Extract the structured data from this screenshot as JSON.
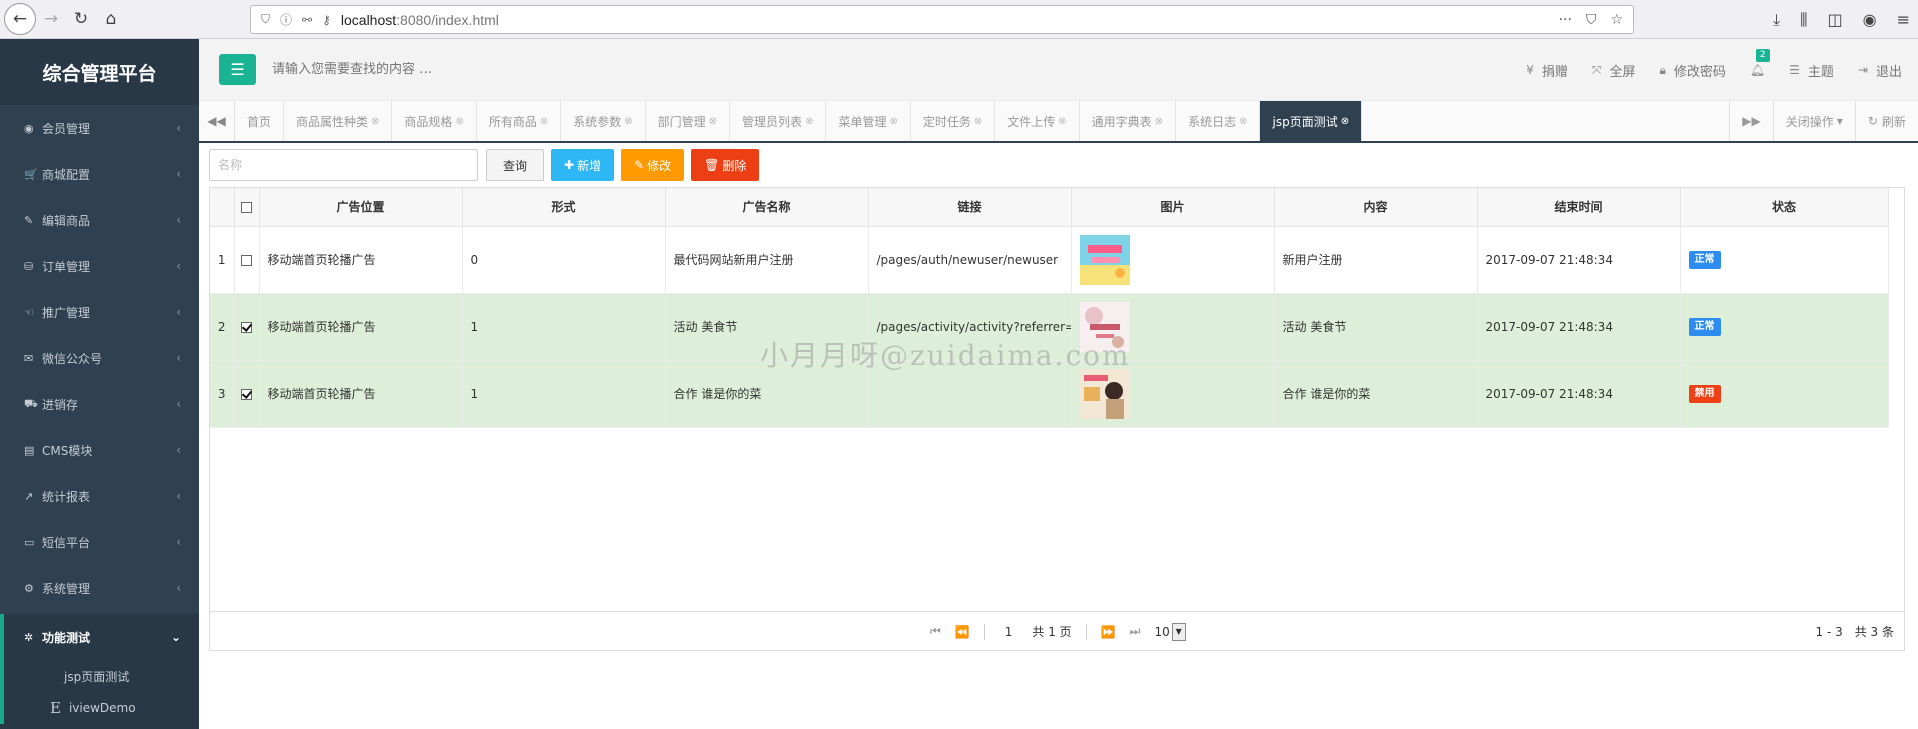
{
  "browser": {
    "url_host": "localhost",
    "url_rest": ":8080/index.html"
  },
  "sidebar": {
    "brand": "综合管理平台",
    "items": [
      {
        "icon": "user-circle-icon",
        "glyph": "◉",
        "label": "会员管理"
      },
      {
        "icon": "cart-icon",
        "glyph": "🛒",
        "label": "商城配置"
      },
      {
        "icon": "edit-icon",
        "glyph": "✎",
        "label": "编辑商品"
      },
      {
        "icon": "database-icon",
        "glyph": "⛁",
        "label": "订单管理"
      },
      {
        "icon": "hand-icon",
        "glyph": "☜",
        "label": "推广管理"
      },
      {
        "icon": "wechat-icon",
        "glyph": "✉",
        "label": "微信公众号"
      },
      {
        "icon": "truck-icon",
        "glyph": "⛟",
        "label": "进销存"
      },
      {
        "icon": "book-icon",
        "glyph": "▤",
        "label": "CMS模块"
      },
      {
        "icon": "chart-line-icon",
        "glyph": "↗",
        "label": "统计报表"
      },
      {
        "icon": "monitor-icon",
        "glyph": "▭",
        "label": "短信平台"
      },
      {
        "icon": "gear-icon",
        "glyph": "⚙",
        "label": "系统管理"
      }
    ],
    "active": {
      "icon": "bug-icon",
      "glyph": "✲",
      "label": "功能测试"
    },
    "sub": [
      {
        "label": "jsp页面测试"
      },
      {
        "icon_letter": "E",
        "label": "iviewDemo"
      }
    ]
  },
  "topbar": {
    "search_placeholder": "请输入您需要查找的内容 …",
    "actions": {
      "donate": "捐赠",
      "fullscreen": "全屏",
      "change_password": "修改密码",
      "notify_count": "2",
      "theme": "主题",
      "logout": "退出"
    }
  },
  "tabs": {
    "items": [
      "首页",
      "商品属性种类",
      "商品规格",
      "所有商品",
      "系统参数",
      "部门管理",
      "管理员列表",
      "菜单管理",
      "定时任务",
      "文件上传",
      "通用字典表",
      "系统日志",
      "jsp页面测试"
    ],
    "close_ops": "关闭操作",
    "refresh": "刷新"
  },
  "toolbar": {
    "name_placeholder": "名称",
    "query": "查询",
    "add": "新增",
    "edit": "修改",
    "delete": "删除"
  },
  "table": {
    "headers": [
      "广告位置",
      "形式",
      "广告名称",
      "链接",
      "图片",
      "内容",
      "结束时间",
      "状态"
    ],
    "rows": [
      {
        "no": "1",
        "checked": false,
        "position": "移动端首页轮播广告",
        "form": "0",
        "name": "最代码网站新用户注册",
        "link": "/pages/auth/newuser/newuser",
        "image": "promo-banner-image",
        "content": "新用户注册",
        "end_time": "2017-09-07 21:48:34",
        "status": "正常",
        "status_color": "#2d8cf0"
      },
      {
        "no": "2",
        "checked": true,
        "position": "移动端首页轮播广告",
        "form": "1",
        "name": "活动 美食节",
        "link": "/pages/activity/activity?referrer=",
        "image": "food-festival-image",
        "content": "活动 美食节",
        "end_time": "2017-09-07 21:48:34",
        "status": "正常",
        "status_color": "#2d8cf0"
      },
      {
        "no": "3",
        "checked": true,
        "position": "移动端首页轮播广告",
        "form": "1",
        "name": "合作 谁是你的菜",
        "link": "",
        "image": "cooperation-image",
        "content": "合作 谁是你的菜",
        "end_time": "2017-09-07 21:48:34",
        "status": "禁用",
        "status_color": "#ed4014"
      }
    ]
  },
  "pager": {
    "page": "1",
    "total_pages": "共 1 页",
    "page_size": "10",
    "range": "1 - 3",
    "total": "共 3 条"
  },
  "watermark": "小月月呀@zuidaima.com"
}
